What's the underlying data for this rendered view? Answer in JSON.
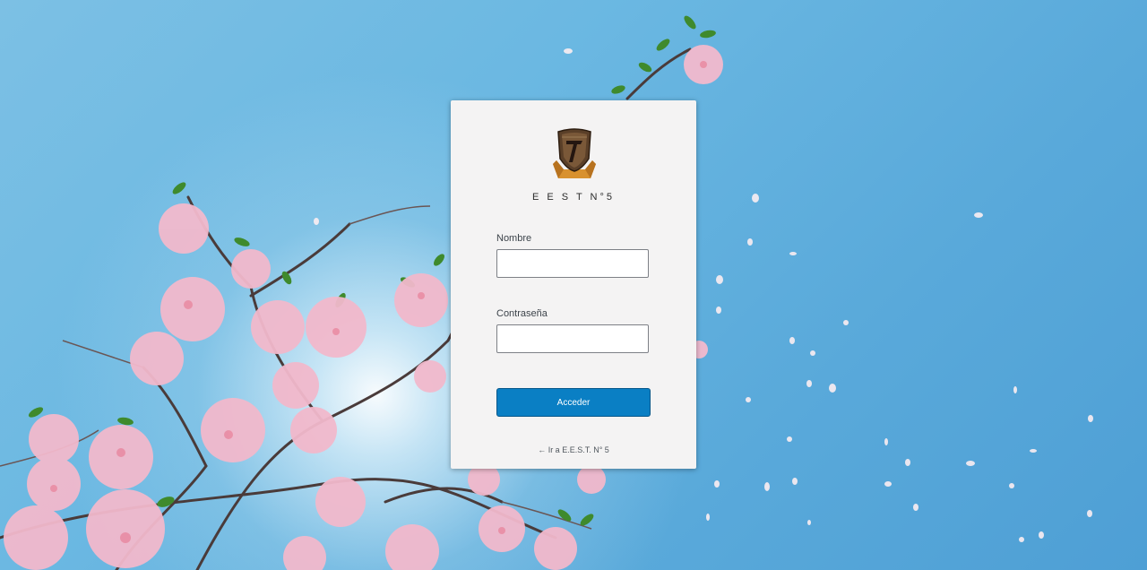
{
  "site": {
    "name": "E E S T N°5"
  },
  "login_form": {
    "username_label": "Nombre",
    "username_value": "",
    "password_label": "Contraseña",
    "password_value": "",
    "submit_label": "Acceder"
  },
  "back_link": {
    "label": "← Ir a E.E.S.T. N° 5"
  },
  "icons": {
    "logo": "school-crest-icon"
  },
  "colors": {
    "primary_button": "#0a7fc4",
    "card_background": "#f4f3f3",
    "sky": "#5ba9da"
  }
}
